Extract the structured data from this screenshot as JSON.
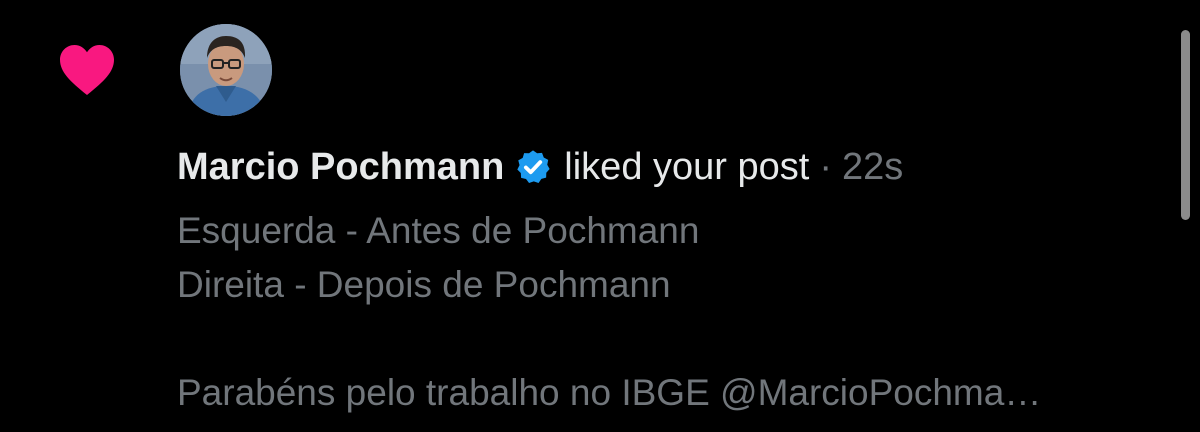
{
  "notification": {
    "type_icon": "heart-icon",
    "type_icon_color": "#f91880",
    "avatar_description": "profile-photo",
    "user_name": "Marcio Pochmann",
    "verified_icon": "verified-badge-icon",
    "verified_color": "#1d9bf0",
    "action": "liked your post",
    "separator": "·",
    "time": "22s",
    "post_preview": {
      "line1": "Esquerda - Antes de Pochmann",
      "line2": "Direita - Depois de Pochmann",
      "line3": "Parabéns pelo trabalho no IBGE @MarcioPochma…"
    }
  },
  "colors": {
    "background": "#000000",
    "primary_text": "#e7e9ea",
    "secondary_text": "#71767b"
  }
}
